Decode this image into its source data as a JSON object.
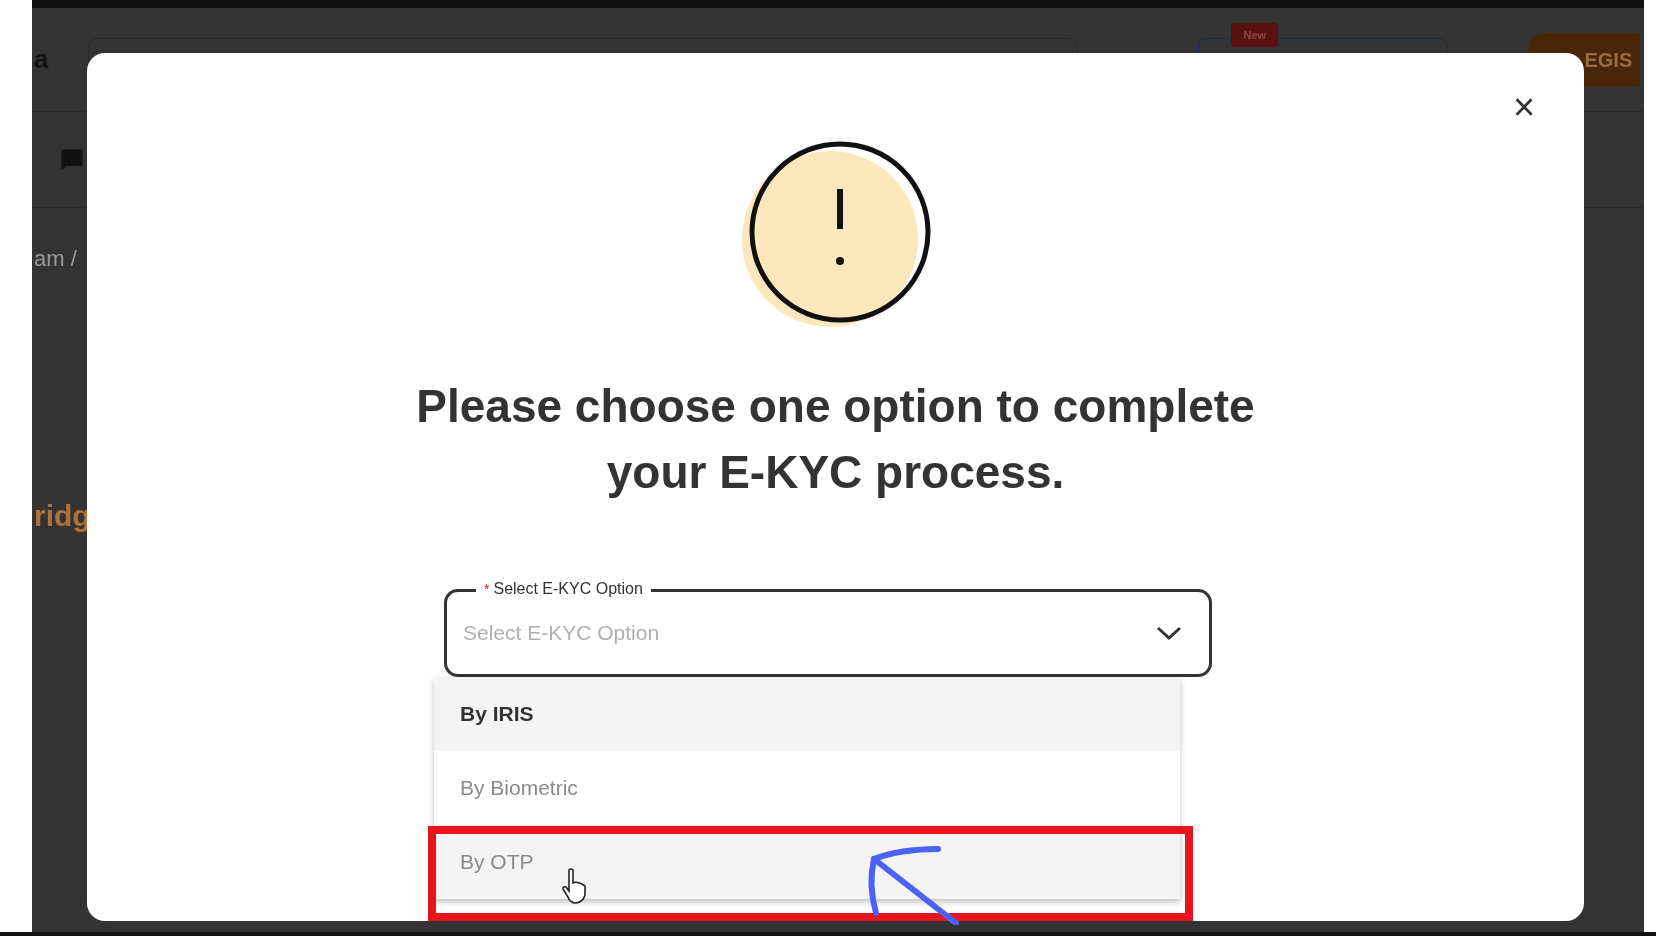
{
  "background": {
    "logo": "a",
    "new_badge": "New",
    "register_button": "EGIS",
    "breadcrumb": "am /",
    "heading": "ridg"
  },
  "dialog": {
    "close": "×",
    "message": "Please choose one option to complete your E-KYC process.",
    "field": {
      "label": "Select E-KYC Option",
      "required": true,
      "required_mark": "*",
      "placeholder": "Select E-KYC Option",
      "expanded": true
    },
    "options": [
      {
        "label": "By IRIS",
        "selected": true,
        "hovered": false,
        "annotated": false
      },
      {
        "label": "By Biometric",
        "selected": false,
        "hovered": false,
        "annotated": false
      },
      {
        "label": "By OTP",
        "selected": false,
        "hovered": true,
        "annotated": true
      }
    ]
  }
}
